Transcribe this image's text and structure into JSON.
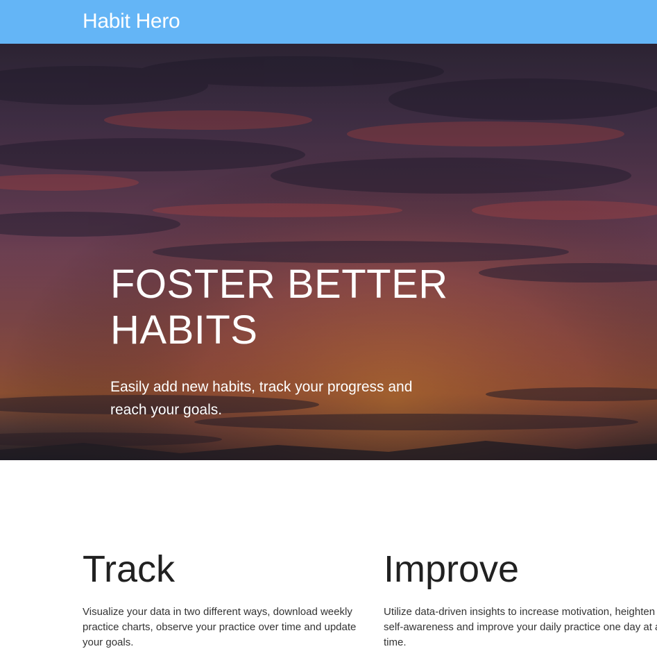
{
  "navbar": {
    "brand": "Habit Hero",
    "color": "#64b5f6"
  },
  "hero": {
    "title_line1": "FOSTER BETTER",
    "title_line2": "HABITS",
    "subtitle": "Easily add new habits, track your progress and reach your goals.",
    "background": "sunset-sky-image"
  },
  "features": [
    {
      "title": "Track",
      "text": "Visualize your data in two different ways, download weekly practice charts, observe your practice over time and update your goals."
    },
    {
      "title": "Improve",
      "text": "Utilize data-driven insights to increase motivation, heighten self-awareness and improve your daily practice one day at a time."
    }
  ]
}
